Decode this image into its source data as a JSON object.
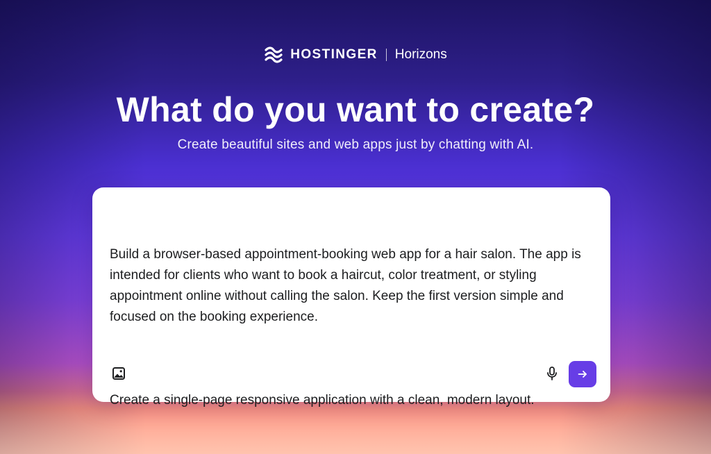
{
  "brand": {
    "name": "HOSTINGER",
    "product": "Horizons",
    "logo_icon": "hostinger-waves-icon"
  },
  "hero": {
    "title": "What do you want to create?",
    "subtitle": "Create beautiful sites and web apps just by chatting with AI."
  },
  "prompt": {
    "paragraphs": [
      "Build a browser-based appointment-booking web app for a hair salon. The app is intended for clients who want to book a haircut, color treatment, or styling appointment online without calling the salon. Keep the first version simple and focused on the booking experience.",
      "Create a single-page responsive application with a clean, modern layout."
    ],
    "attach_icon": "image-icon",
    "mic_icon": "microphone-icon",
    "send_icon": "arrow-right-icon"
  },
  "colors": {
    "accent": "#673de6",
    "card_bg": "#ffffff",
    "text_dark": "#1d1e20"
  }
}
